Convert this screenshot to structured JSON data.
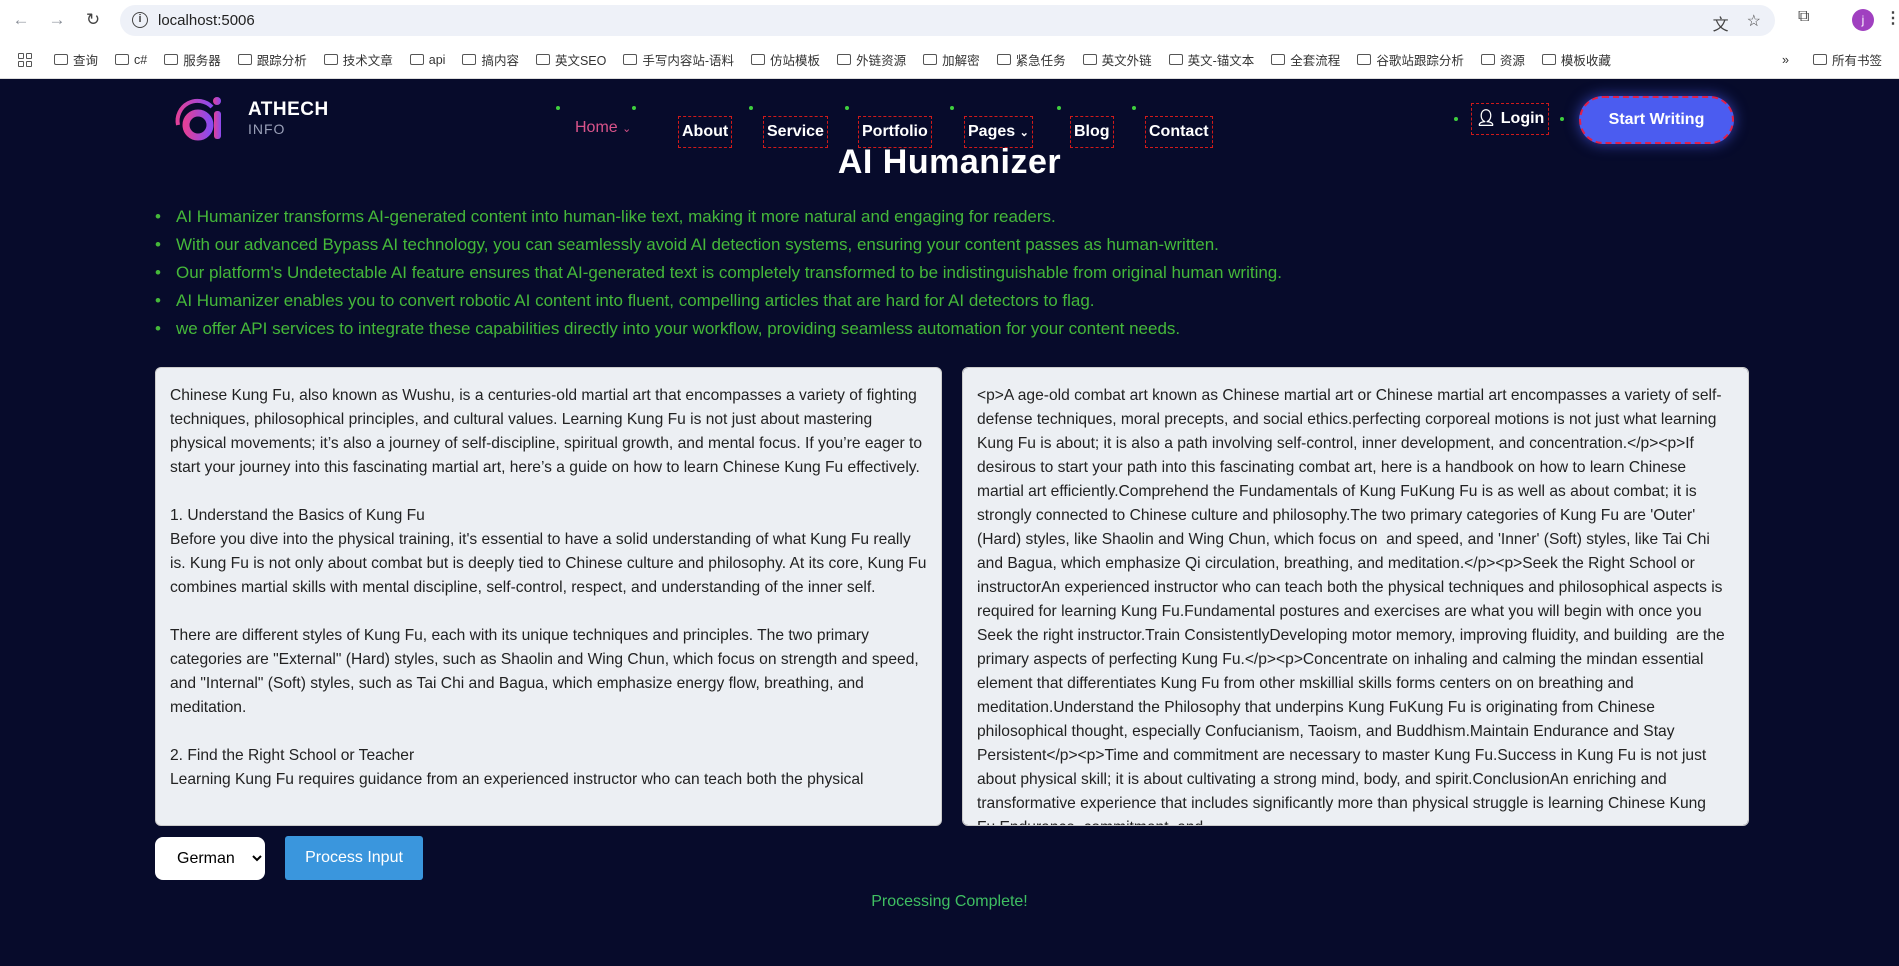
{
  "browser": {
    "url": "localhost:5006",
    "avatar_letter": "j",
    "bookmarks": [
      "查询",
      "c#",
      "服务器",
      "跟踪分析",
      "技术文章",
      "api",
      "搞内容",
      "英文SEO",
      "手写内容站-语料",
      "仿站模板",
      "外链资源",
      "加解密",
      "紧急任务",
      "英文外链",
      "英文-锚文本",
      "全套流程",
      "谷歌站跟踪分析",
      "资源",
      "模板收藏"
    ],
    "more": "»",
    "all_bookmarks": "所有书签"
  },
  "header": {
    "brand": "ATHECH",
    "brand_sub": "INFO",
    "nav": {
      "home": "Home",
      "about": "About",
      "service": "Service",
      "portfolio": "Portfolio",
      "pages": "Pages",
      "blog": "Blog",
      "contact": "Contact"
    },
    "login": "Login",
    "start_writing": "Start Writing"
  },
  "colors": {
    "background": "#070b2b",
    "accent_green": "#45b83a",
    "button_blue": "#3a96dd",
    "cta": "#4b5cf0"
  },
  "main": {
    "title": "AI Humanizer",
    "bullets": [
      "AI Humanizer transforms AI-generated content into human-like text, making it more natural and engaging for readers.",
      "With our advanced Bypass AI technology, you can seamlessly avoid AI detection systems, ensuring your content passes as human-written.",
      "Our platform's Undetectable AI feature ensures that AI-generated text is completely transformed to be indistinguishable from original human writing.",
      "AI Humanizer enables you to convert robotic AI content into fluent, compelling articles that are hard for AI detectors to flag.",
      "we offer API services to integrate these capabilities directly into your workflow, providing seamless automation for your content needs."
    ],
    "input_text": "Chinese Kung Fu, also known as Wushu, is a centuries-old martial art that encompasses a variety of fighting techniques, philosophical principles, and cultural values. Learning Kung Fu is not just about mastering physical movements; it’s also a journey of self-discipline, spiritual growth, and mental focus. If you’re eager to start your journey into this fascinating martial art, here’s a guide on how to learn Chinese Kung Fu effectively.\n\n1. Understand the Basics of Kung Fu\nBefore you dive into the physical training, it's essential to have a solid understanding of what Kung Fu really is. Kung Fu is not only about combat but is deeply tied to Chinese culture and philosophy. At its core, Kung Fu combines martial skills with mental discipline, self-control, respect, and understanding of the inner self.\n\nThere are different styles of Kung Fu, each with its unique techniques and principles. The two primary categories are \"External\" (Hard) styles, such as Shaolin and Wing Chun, which focus on strength and speed, and \"Internal\" (Soft) styles, such as Tai Chi and Bagua, which emphasize energy flow, breathing, and meditation.\n\n2. Find the Right School or Teacher\nLearning Kung Fu requires guidance from an experienced instructor who can teach both the physical",
    "output_text": "<p>A age-old combat art known as Chinese martial art or Chinese martial art encompasses a variety of self-defense techniques, moral precepts, and social ethics.perfecting corporeal motions is not just what learning Kung Fu is about; it is also a path involving self-control, inner development, and concentration.</p><p>If desirous to start your path into this fascinating combat art, here is a handbook on how to learn Chinese martial art efficiently.Comprehend the Fundamentals of Kung FuKung Fu is as well as about combat; it is strongly connected to Chinese culture and philosophy.The two primary categories of Kung Fu are 'Outer' (Hard) styles, like Shaolin and Wing Chun, which focus on  and speed, and 'Inner' (Soft) styles, like Tai Chi and Bagua, which emphasize Qi circulation, breathing, and meditation.</p><p>Seek the Right School or instructorAn experienced instructor who can teach both the physical techniques and philosophical aspects is required for learning Kung Fu.Fundamental postures and exercises are what you will begin with once you Seek the right instructor.Train ConsistentlyDeveloping motor memory, improving fluidity, and building  are the primary aspects of perfecting Kung Fu.</p><p>Concentrate on inhaling and calming the mindan essential element that differentiates Kung Fu from other mskillial skills forms centers on on breathing and meditation.Understand the Philosophy that underpins Kung FuKung Fu is originating from Chinese philosophical thought, especially Confucianism, Taoism, and Buddhism.Maintain Endurance and Stay Persistent</p><p>Time and commitment are necessary to master Kung Fu.Success in Kung Fu is not just about physical skill; it is about cultivating a strong mind, body, and spirit.ConclusionAn enriching and transformative experience that includes significantly more than physical struggle is learning Chinese Kung Fu.Endurance, commitment, and",
    "language": "German",
    "process_label": "Process Input",
    "status": "Processing Complete!"
  }
}
